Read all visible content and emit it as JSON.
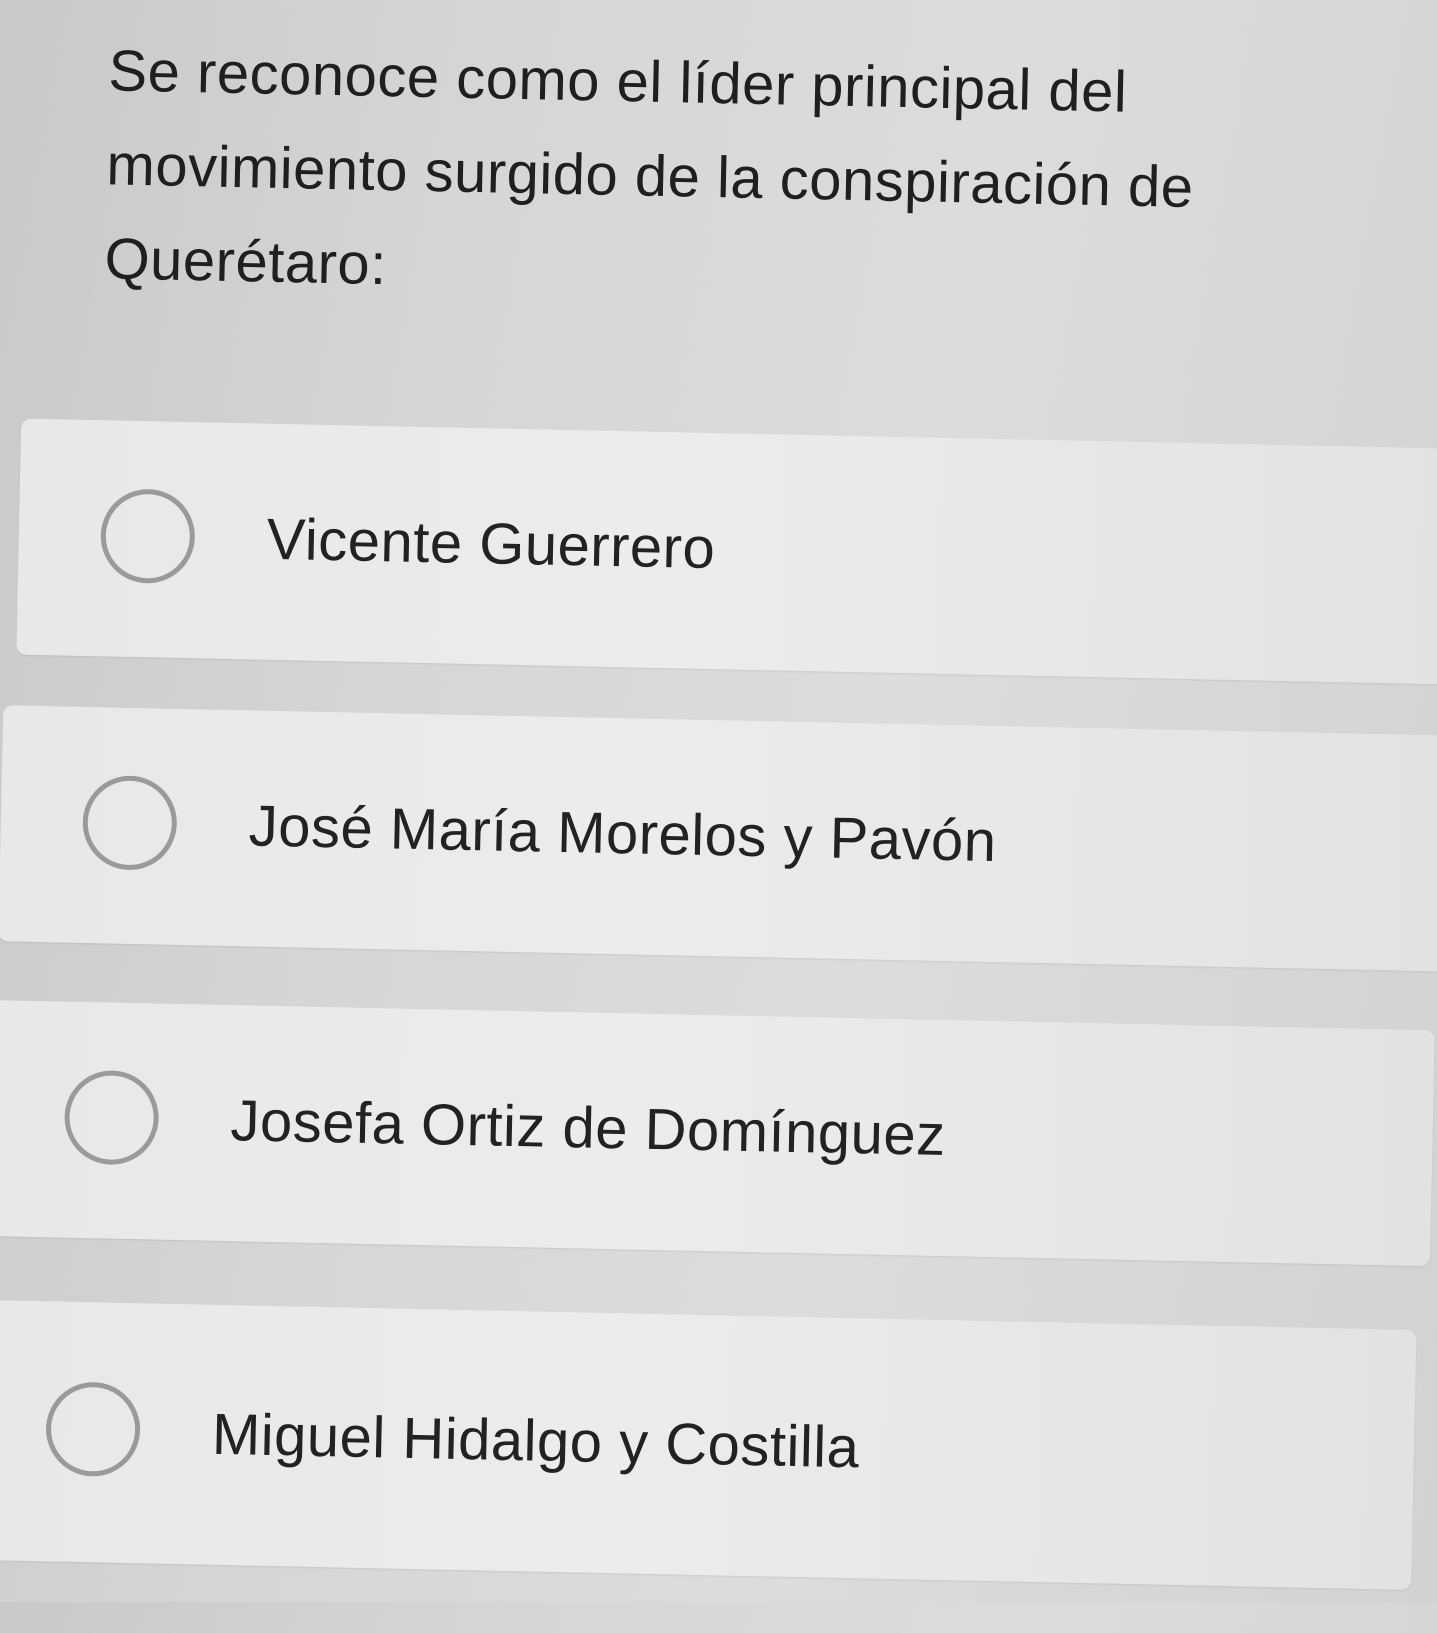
{
  "question": {
    "text": "Se reconoce como el líder principal del movimiento surgido de la conspiración de Querétaro:"
  },
  "options": [
    {
      "label": "Vicente Guerrero",
      "selected": false
    },
    {
      "label": "José María Morelos y Pavón",
      "selected": false
    },
    {
      "label": "Josefa Ortiz de Domínguez",
      "selected": false
    },
    {
      "label": "Miguel Hidalgo y Costilla",
      "selected": false
    }
  ],
  "colors": {
    "background": "#d6d6d4",
    "option_background": "#eaeae8",
    "radio_border": "#9a9a98",
    "text": "#222222"
  }
}
